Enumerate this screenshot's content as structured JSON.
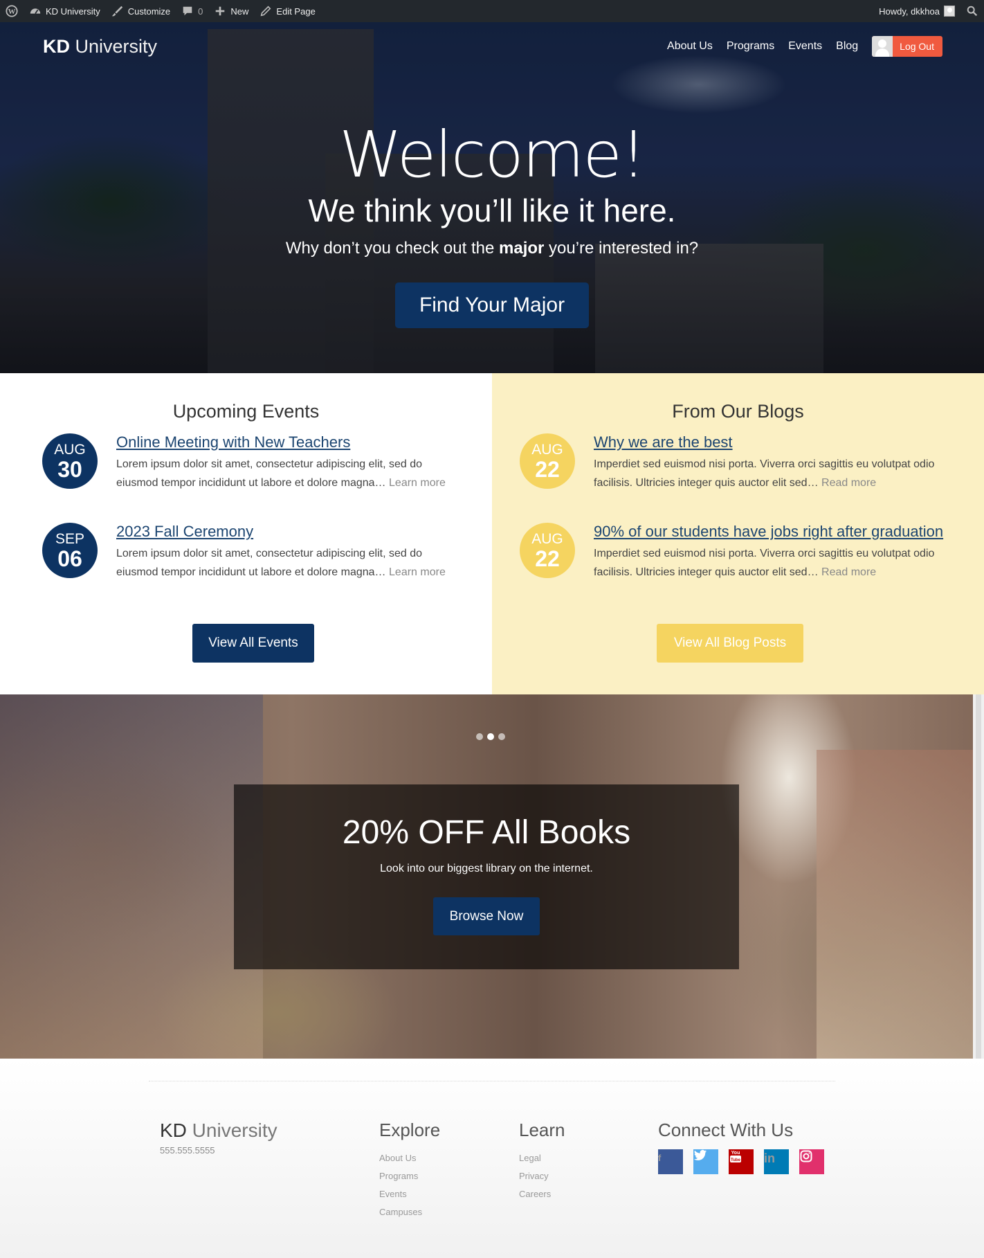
{
  "adminbar": {
    "site": "KD University",
    "customize": "Customize",
    "comments": "0",
    "new": "New",
    "edit": "Edit Page",
    "howdy": "Howdy, dkkhoa"
  },
  "header": {
    "logo_bold": "KD",
    "logo_rest": " University",
    "nav": [
      "About Us",
      "Programs",
      "Events",
      "Blog"
    ],
    "logout": "Log Out"
  },
  "hero": {
    "welcome": "Welcome!",
    "tagline": "We think you’ll like it here.",
    "question_pre": "Why don’t you check out the ",
    "question_bold": "major",
    "question_post": " you’re interested in?",
    "button": "Find Your Major"
  },
  "events": {
    "title": "Upcoming Events",
    "items": [
      {
        "month": "AUG",
        "day": "30",
        "title": "Online Meeting with New Teachers",
        "desc": "Lorem ipsum dolor sit amet, consectetur adipiscing elit, sed do eiusmod tempor incididunt ut labore et dolore magna…",
        "more": "Learn more"
      },
      {
        "month": "SEP",
        "day": "06",
        "title": "2023 Fall Ceremony",
        "desc": "Lorem ipsum dolor sit amet, consectetur adipiscing elit, sed do eiusmod tempor incididunt ut labore et dolore magna…",
        "more": "Learn more"
      }
    ],
    "button": "View All Events"
  },
  "blogs": {
    "title": "From Our Blogs",
    "items": [
      {
        "month": "AUG",
        "day": "22",
        "title": "Why we are the best",
        "desc": "Imperdiet sed euismod nisi porta. Viverra orci sagittis eu volutpat odio facilisis. Ultricies integer quis auctor elit sed…",
        "more": "Read more"
      },
      {
        "month": "AUG",
        "day": "22",
        "title": "90% of our students have jobs right after graduation",
        "desc": "Imperdiet sed euismod nisi porta. Viverra orci sagittis eu volutpat odio facilisis. Ultricies integer quis auctor elit sed…",
        "more": "Read more"
      }
    ],
    "button": "View All Blog Posts"
  },
  "promo": {
    "title": "20% OFF All Books",
    "subtitle": "Look into our biggest library on the internet.",
    "button": "Browse Now"
  },
  "footer": {
    "logo_bold": "KD",
    "logo_rest": " University",
    "phone": "555.555.5555",
    "explore": {
      "title": "Explore",
      "links": [
        "About Us",
        "Programs",
        "Events",
        "Campuses"
      ]
    },
    "learn": {
      "title": "Learn",
      "links": [
        "Legal",
        "Privacy",
        "Careers"
      ]
    },
    "connect": {
      "title": "Connect With Us",
      "icons": [
        "facebook-icon",
        "twitter-icon",
        "youtube-icon",
        "linkedin-icon",
        "instagram-icon"
      ]
    }
  },
  "colors": {
    "navy": "#0d3362",
    "gold": "#f5d460",
    "cream": "#fbf0c4",
    "logout": "#f05a3f",
    "facebook": "#3b5998",
    "twitter": "#55acee",
    "youtube": "#bb0000",
    "linkedin": "#007bb5",
    "instagram": "#e1306c"
  }
}
